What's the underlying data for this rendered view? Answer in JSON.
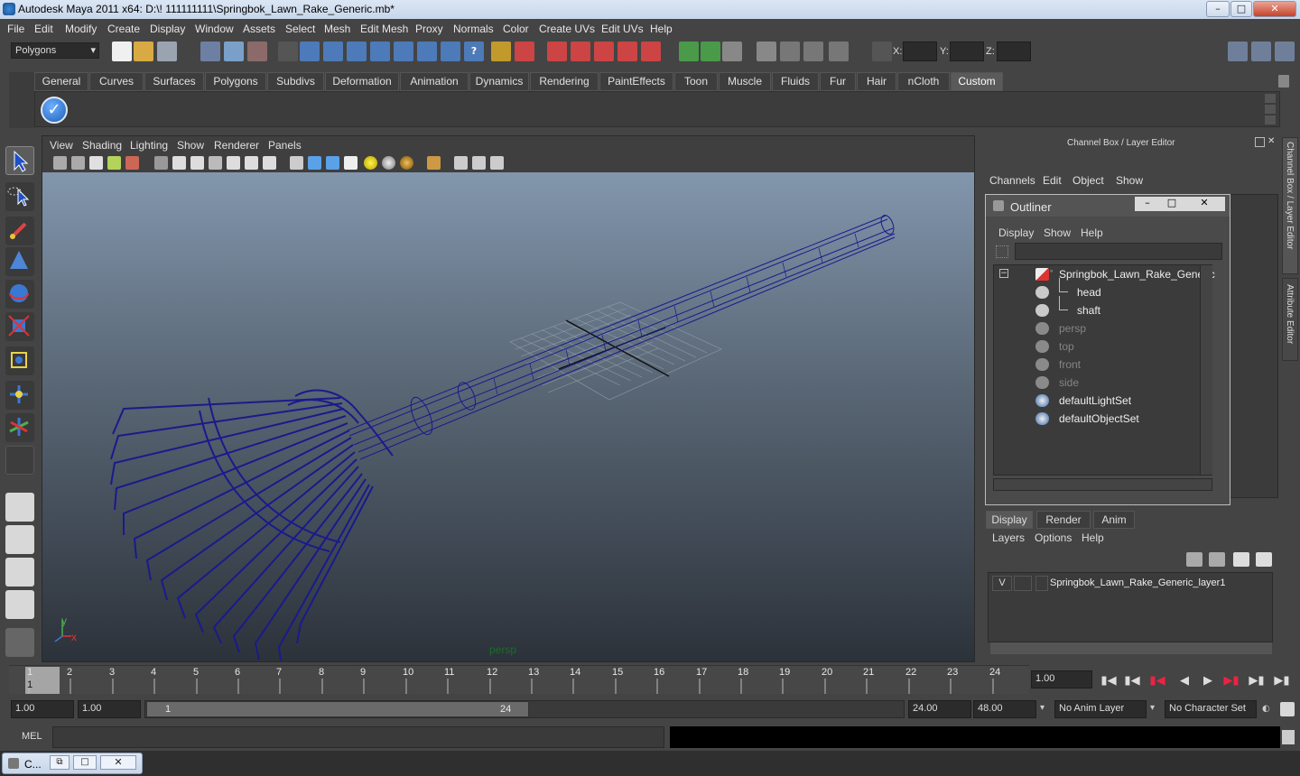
{
  "window": {
    "title": "Autodesk Maya 2011 x64: D:\\! 111111111\\Springbok_Lawn_Rake_Generic.mb*"
  },
  "menubar": [
    "File",
    "Edit",
    "Modify",
    "Create",
    "Display",
    "Window",
    "Assets",
    "Select",
    "Mesh",
    "Edit Mesh",
    "Proxy",
    "Normals",
    "Color",
    "Create UVs",
    "Edit UVs",
    "Help"
  ],
  "statusline": {
    "mode": "Polygons",
    "x_label": "X:",
    "y_label": "Y:",
    "z_label": "Z:"
  },
  "shelf": {
    "tabs": [
      "General",
      "Curves",
      "Surfaces",
      "Polygons",
      "Subdivs",
      "Deformation",
      "Animation",
      "Dynamics",
      "Rendering",
      "PaintEffects",
      "Toon",
      "Muscle",
      "Fluids",
      "Fur",
      "Hair",
      "nCloth",
      "Custom"
    ],
    "active": "Custom"
  },
  "viewport": {
    "menus": [
      "View",
      "Shading",
      "Lighting",
      "Show",
      "Renderer",
      "Panels"
    ],
    "camera_label": "persp",
    "axis_y": "y",
    "axis_x": "x",
    "wire_color": "#1a1a8c"
  },
  "channelbox": {
    "title": "Channel Box / Layer Editor",
    "menus": [
      "Channels",
      "Edit",
      "Object",
      "Show"
    ],
    "side_tab_1": "Channel Box / Layer Editor",
    "side_tab_2": "Attribute Editor"
  },
  "outliner": {
    "title": "Outliner",
    "menus": [
      "Display",
      "Show",
      "Help"
    ],
    "items": [
      {
        "label": "Springbok_Lawn_Rake_Generic",
        "dim": false
      },
      {
        "label": "head",
        "dim": false
      },
      {
        "label": "shaft",
        "dim": false
      },
      {
        "label": "persp",
        "dim": true
      },
      {
        "label": "top",
        "dim": true
      },
      {
        "label": "front",
        "dim": true
      },
      {
        "label": "side",
        "dim": true
      },
      {
        "label": "defaultLightSet",
        "dim": false
      },
      {
        "label": "defaultObjectSet",
        "dim": false
      }
    ]
  },
  "layer_editor": {
    "tabs": [
      "Display",
      "Render",
      "Anim"
    ],
    "active": "Display",
    "menus": [
      "Layers",
      "Options",
      "Help"
    ],
    "layer": {
      "visible": "V",
      "name": "Springbok_Lawn_Rake_Generic_layer1"
    }
  },
  "timeslider": {
    "ticks": [
      "1",
      "2",
      "3",
      "4",
      "5",
      "6",
      "7",
      "8",
      "9",
      "10",
      "11",
      "12",
      "13",
      "14",
      "15",
      "16",
      "17",
      "18",
      "19",
      "20",
      "21",
      "22",
      "23",
      "24"
    ],
    "current_frame_marker": "1",
    "current_time": "1.00"
  },
  "rangeslider": {
    "start_time": "1.00",
    "playback_start": "1.00",
    "range_start_label": "1",
    "range_end_label": "24",
    "playback_end": "24.00",
    "end_time": "48.00",
    "anim_layer": "No Anim Layer",
    "character_set": "No Character Set"
  },
  "cmdline": {
    "label": "MEL"
  },
  "taskbar": {
    "item": "C..."
  }
}
